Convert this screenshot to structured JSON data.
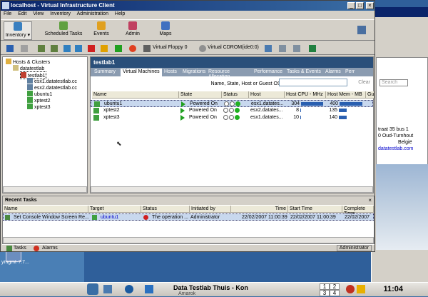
{
  "window": {
    "title": "localhost - Virtual Infrastructure Client"
  },
  "menu": [
    "File",
    "Edit",
    "View",
    "Inventory",
    "Administration",
    "Help"
  ],
  "toolbar": [
    {
      "label": "Inventory ▾",
      "icon": "inventory-icon"
    },
    {
      "label": "Scheduled Tasks",
      "icon": "scheduled-tasks-icon"
    },
    {
      "label": "Events",
      "icon": "events-icon"
    },
    {
      "label": "Admin",
      "icon": "admin-icon"
    },
    {
      "label": "Maps",
      "icon": "maps-icon"
    }
  ],
  "toolbar2": {
    "floppy": "Virtual Floppy 0",
    "cdrom": "Virtual CDROM(ide0:0)"
  },
  "tree": [
    {
      "label": "Hosts & Clusters",
      "indent": 0
    },
    {
      "label": "datatestlab",
      "indent": 1
    },
    {
      "label": "testlab1",
      "indent": 2
    },
    {
      "label": "esx1.datatestlab.cc",
      "indent": 3
    },
    {
      "label": "esx2.datatestlab.cc",
      "indent": 3
    },
    {
      "label": "ubuntu1",
      "indent": 3
    },
    {
      "label": "xptest2",
      "indent": 3
    },
    {
      "label": "xptest3",
      "indent": 3
    }
  ],
  "panel": {
    "title": "testlab1",
    "tabs": [
      "Summary",
      "Virtual Machines",
      "Hosts",
      "Migrations",
      "Resource Allocation",
      "Performance",
      "Tasks & Events",
      "Alarms",
      "Perr"
    ],
    "active_tab": 1,
    "filter_label": "Name, State, Host or Guest OS contains: ▾",
    "clear_label": "Clear",
    "columns": [
      "Name",
      "State",
      "Status",
      "Host",
      "Host CPU - MHz",
      "Host Mem - MB",
      "Gu"
    ],
    "rows": [
      {
        "name": "ubuntu1",
        "state": "Powered On",
        "host": "esx1.datates...",
        "cpu": "304",
        "cpu_frac": 0.9,
        "mem": "400",
        "mem_frac": 1.0
      },
      {
        "name": "xptest2",
        "state": "Powered On",
        "host": "esx2.datates...",
        "cpu": "8",
        "cpu_frac": 0.02,
        "mem": "135",
        "mem_frac": 0.33
      },
      {
        "name": "xptest3",
        "state": "Powered On",
        "host": "esx1.datates...",
        "cpu": "10",
        "cpu_frac": 0.03,
        "mem": "140",
        "mem_frac": 0.35
      }
    ]
  },
  "recent_tasks": {
    "title": "Recent Tasks",
    "columns": [
      "Name",
      "Target",
      "Status",
      "Initiated by",
      "Time",
      "Start Time",
      "Complete Time"
    ],
    "row": {
      "name": "Set Console Window Screen Re...",
      "target": "ubuntu1",
      "status": "The operation ...",
      "initiated": "Administrator",
      "time": "22/02/2007 11:00:39",
      "start": "22/02/2007 11:00:39",
      "complete": "22/02/2007"
    }
  },
  "statusbar": {
    "tasks": "Tasks",
    "alarms": "Alarms",
    "user": "Administrator"
  },
  "background_app": {
    "text1": "Search",
    "text2": "traat 35 bus 1",
    "text3": "0 Oud-Turnhout",
    "text4": "België",
    "text5": "datatestlab.com"
  },
  "desktop": {
    "icon_label": "ymgmt-7.7..."
  },
  "taskbar": {
    "app": "Data Testlab Thuis - Kon",
    "app2": "Amarok",
    "pages": [
      "1",
      "2",
      "3",
      "4"
    ],
    "clock": "11:04"
  }
}
